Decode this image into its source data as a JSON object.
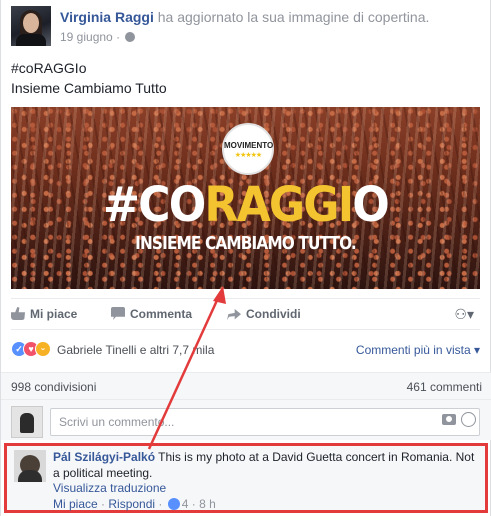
{
  "post": {
    "author": "Virginia Raggi",
    "action": "ha aggiornato la sua immagine di copertina.",
    "date": "19 giugno",
    "separator": "·",
    "text_line1": "#coRAGGIo",
    "text_line2": "Insieme Cambiamo Tutto"
  },
  "cover": {
    "logo_word": "MOVIMENTO",
    "logo_stars": "★★★★★",
    "title_prefix": "#CO",
    "title_highlight": "RAGGI",
    "title_suffix": "O",
    "subtitle": "INSIEME CAMBIAMO TUTTO."
  },
  "actions": {
    "like": "Mi piace",
    "comment": "Commenta",
    "share": "Condividi",
    "audience_icon": "people-icon"
  },
  "reactions": {
    "names": "Gabriele Tinelli e altri 7,7 mila",
    "sort": "Commenti più in vista",
    "sort_caret": "▾",
    "like_glyph": "👍",
    "love_glyph": "♥",
    "haha_glyph": "😆"
  },
  "counts": {
    "shares": "998 condivisioni",
    "comments": "461 commenti"
  },
  "composer": {
    "placeholder": "Scrivi un commento..."
  },
  "comment": {
    "author": "Pál Szilágyi-Palkó",
    "text": "This is my photo at a David Guetta concert in Romania. Not a political meeting.",
    "translate": "Visualizza traduzione",
    "like": "Mi piace",
    "reply": "Rispondi",
    "dot": "·",
    "likes": "4",
    "time": "8 h"
  },
  "colors": {
    "link": "#365899",
    "highlight": "#e33b3b",
    "title_accent": "#f4c430"
  }
}
